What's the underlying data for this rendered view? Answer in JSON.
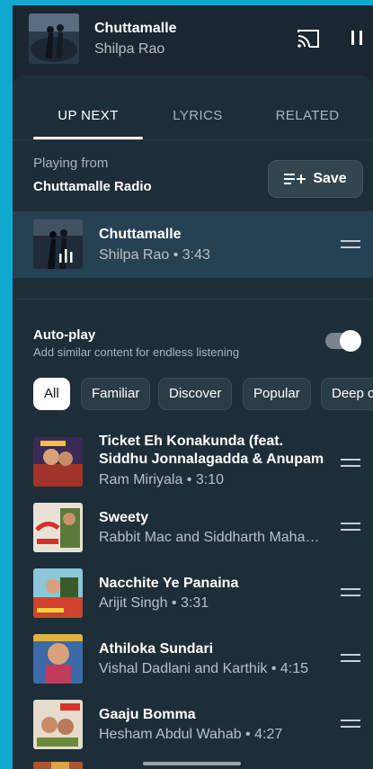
{
  "mini_player": {
    "title": "Chuttamalle",
    "artist": "Shilpa Rao"
  },
  "tabs": [
    {
      "label": "UP NEXT",
      "active": true
    },
    {
      "label": "LYRICS",
      "active": false
    },
    {
      "label": "RELATED",
      "active": false
    }
  ],
  "playing": {
    "prefix": "Playing from",
    "source": "Chuttamalle Radio"
  },
  "save_button": {
    "label": "Save",
    "icon": "playlist-add-icon"
  },
  "current_track": {
    "title": "Chuttamalle",
    "subtitle": "Shilpa Rao • 3:43",
    "is_playing": true
  },
  "autoplay": {
    "title": "Auto-play",
    "subtitle": "Add similar content for endless listening",
    "enabled": true
  },
  "chips": [
    "All",
    "Familiar",
    "Discover",
    "Popular",
    "Deep cuts"
  ],
  "queue": [
    {
      "title_line1": "Ticket Eh Konakunda (feat.",
      "title_line2": "Siddhu Jonnalagadda & Anupam…",
      "subtitle": "Ram Miriyala • 3:10"
    },
    {
      "title": "Sweety",
      "subtitle": "Rabbit Mac and Siddharth Maha…"
    },
    {
      "title": "Nacchite Ye Panaina",
      "subtitle": "Arijit Singh • 3:31"
    },
    {
      "title": "Athiloka Sundari",
      "subtitle": "Vishal Dadlani and Karthik • 4:15"
    },
    {
      "title": "Gaaju Bomma",
      "subtitle": "Hesham Abdul Wahab • 4:27"
    }
  ],
  "colors": {
    "background_frame": "#0fa8cf",
    "panel": "#1e2e39",
    "current_row": "#264252"
  }
}
